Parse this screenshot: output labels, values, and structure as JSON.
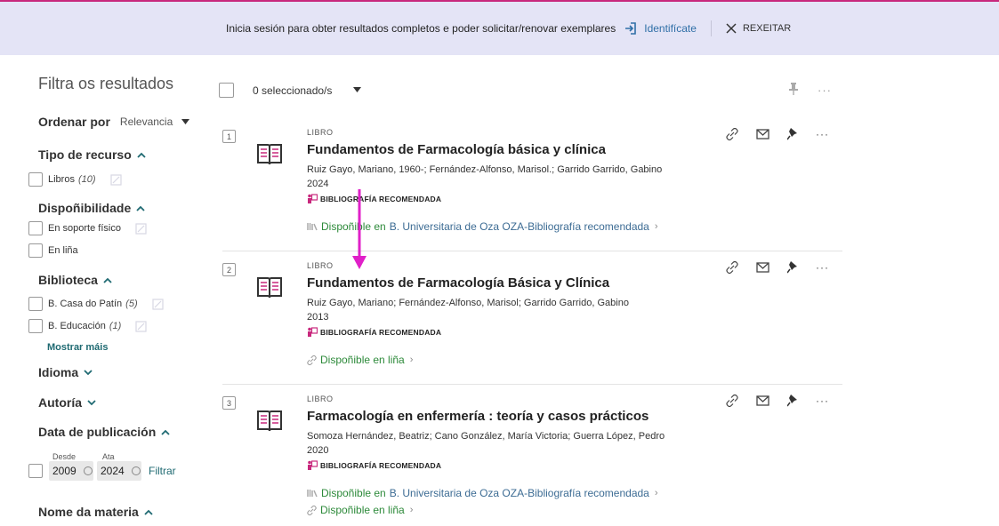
{
  "banner": {
    "message": "Inicia sesión para obter resultados completos e poder solicitar/renovar exemplares",
    "signin_label": "Identifícate",
    "dismiss_label": "REXEITAR"
  },
  "sidebar": {
    "title": "Filtra os resultados",
    "sort_label": "Ordenar por",
    "sort_value": "Relevancia",
    "facets": {
      "resource_type": {
        "label": "Tipo de recurso",
        "options": [
          {
            "label": "Libros",
            "count": "(10)"
          }
        ]
      },
      "availability": {
        "label": "Dispoñibilidade",
        "options": [
          {
            "label": "En soporte físico"
          },
          {
            "label": "En liña"
          }
        ]
      },
      "library": {
        "label": "Biblioteca",
        "options": [
          {
            "label": "B. Casa do Patín",
            "count": "(5)"
          },
          {
            "label": "B. Educación",
            "count": "(1)"
          }
        ],
        "show_more": "Mostrar máis"
      },
      "language": {
        "label": "Idioma"
      },
      "author": {
        "label": "Autoría"
      },
      "pub_date": {
        "label": "Data de publicación",
        "from_label": "Desde",
        "to_label": "Ata",
        "from_value": "2009",
        "to_value": "2024",
        "filter_label": "Filtrar"
      },
      "subject": {
        "label": "Nome da materia"
      }
    }
  },
  "results_header": {
    "selected_text": "0 seleccionado/s"
  },
  "results": [
    {
      "number": "1",
      "type": "LIBRO",
      "title": "Fundamentos de Farmacología básica y clínica",
      "authors": "Ruiz Gayo, Mariano, 1960-; Fernández-Alfonso, Marisol.; Garrido Garrido, Gabino",
      "year": "2024",
      "badge": "BIBLIOGRAFÍA RECOMENDADA",
      "avail_prefix": "Dispoñible en",
      "avail_location": "B. Universitaria de Oza  OZA-Bibliografía recomendada"
    },
    {
      "number": "2",
      "type": "LIBRO",
      "title": "Fundamentos de Farmacología Básica y Clínica",
      "authors": "Ruiz Gayo, Mariano; Fernández-Alfonso, Marisol; Garrido Garrido, Gabino",
      "year": "2013",
      "badge": "BIBLIOGRAFÍA RECOMENDADA",
      "online": "Dispoñible en liña"
    },
    {
      "number": "3",
      "type": "LIBRO",
      "title": "Farmacología en enfermería : teoría y casos prácticos",
      "authors": "Somoza Hernández, Beatriz; Cano González, María Victoria; Guerra López, Pedro",
      "year": "2020",
      "badge": "BIBLIOGRAFÍA RECOMENDADA",
      "avail_prefix": "Dispoñible en",
      "avail_location": "B. Universitaria de Oza  OZA-Bibliografía recomendada",
      "online": "Dispoñible en liña"
    }
  ],
  "colors": {
    "accent": "#c8287d",
    "banner_bg": "#e4e4f6",
    "available_green": "#2d8a3a",
    "link_blue": "#3d6c94",
    "teal": "#1f6a72",
    "annotation_magenta": "#e020c8"
  }
}
